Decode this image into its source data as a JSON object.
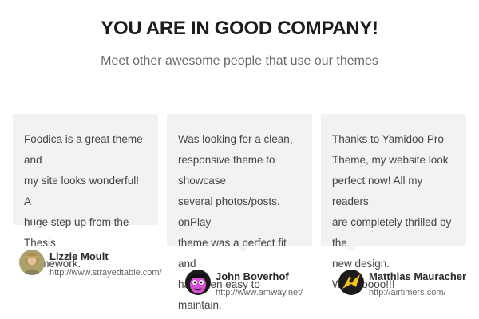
{
  "section": {
    "title": "YOU ARE IN GOOD COMPANY!",
    "subtitle": "Meet other awesome people that use our themes"
  },
  "testimonials": [
    {
      "lines": [
        "Foodica is a great theme and",
        "my site looks wonderful! A",
        "huge step up from the Thesis",
        "Framework."
      ],
      "author": "Lizzie Moult",
      "url": "http://www.strayedtable.com/",
      "avatar_icon": "avatar-woman-photo-icon"
    },
    {
      "lines": [
        "Was looking for a clean,",
        "responsive theme to showcase",
        "several photos/posts. onPlay",
        "theme was a perfect fit and",
        "has been easy to maintain."
      ],
      "author": "John Boverhof",
      "url": "http://www.amway.net/",
      "avatar_icon": "avatar-cartoon-face-icon"
    },
    {
      "lines": [
        "Thanks to Yamidoo Pro",
        "Theme, my website look",
        "perfect now! All my readers",
        "are completely thrilled by the",
        "new design. WooHoooo!!!"
      ],
      "author": "Matthias Mauracher",
      "url": "http://airtimers.com/",
      "avatar_icon": "avatar-yellow-logo-icon"
    }
  ],
  "colors": {
    "card_bg": "#f1f2f4",
    "title": "#1c1c1c",
    "text": "#444444"
  }
}
